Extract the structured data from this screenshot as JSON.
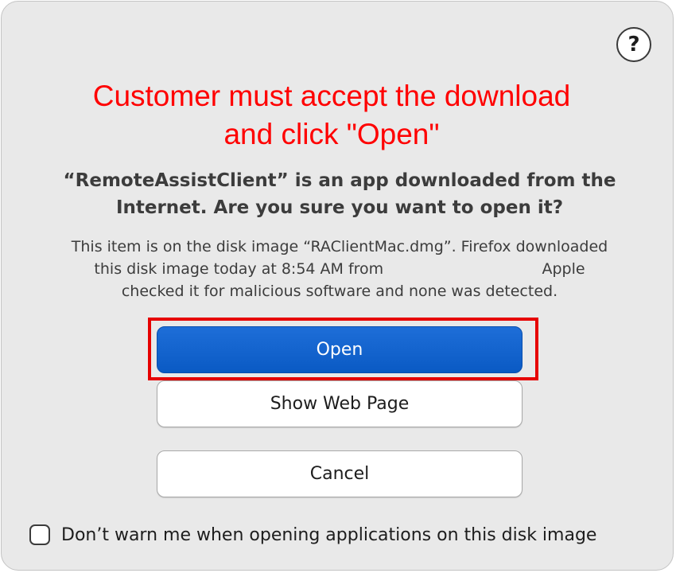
{
  "annotation": {
    "line1": "Customer must accept the download",
    "line2": "and click \"Open\"",
    "color": "#ff0000"
  },
  "help_button": {
    "label": "?"
  },
  "headline": {
    "line1": "“RemoteAssistClient” is an app downloaded from the",
    "line2": "Internet. Are you sure you want to open it?"
  },
  "detail": {
    "line1": "This item is on the disk image “RAClientMac.dmg”. Firefox downloaded",
    "line2": "this disk image today at 8:54 AM from                                 Apple",
    "line3": "checked it for malicious software and none was detected."
  },
  "buttons": {
    "open": "Open",
    "show_web_page": "Show Web Page",
    "cancel": "Cancel"
  },
  "checkbox": {
    "label": "Don’t warn me when opening applications on this disk image",
    "checked": false
  },
  "colors": {
    "primary_button": "#0a5ac4",
    "highlight": "#e60000",
    "dialog_background": "#e9e9e9"
  }
}
